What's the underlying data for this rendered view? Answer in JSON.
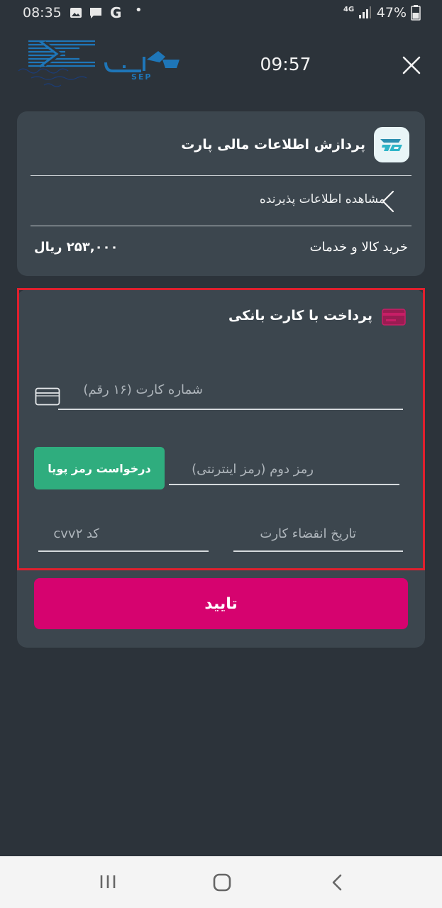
{
  "status_bar": {
    "time": "08:35",
    "network": "4G",
    "battery": "47%"
  },
  "header": {
    "timer": "09:57"
  },
  "merchant": {
    "name": "پردازش اطلاعات مالی پارت",
    "view_info_label": "مشاهده اطلاعات پذیرنده",
    "purchase_label": "خرید کالا و خدمات",
    "amount": "۲۵۳,۰۰۰ ریال"
  },
  "payment": {
    "title": "پرداخت با کارت بانکی",
    "card_number_placeholder": "شماره کارت (۱۶ رقم)",
    "pin2_placeholder": "رمز دوم (رمز اینترنتی)",
    "otp_button_label": "درخواست رمز پویا",
    "expiry_placeholder": "تاریخ انقضاء کارت",
    "cvv2_placeholder": "کد cvv۲",
    "confirm_label": "تایید"
  },
  "colors": {
    "background": "#2c333a",
    "card": "#3c464e",
    "otp_button": "#2fad7e",
    "confirm_button": "#d6036f",
    "highlight": "#e0202e"
  }
}
